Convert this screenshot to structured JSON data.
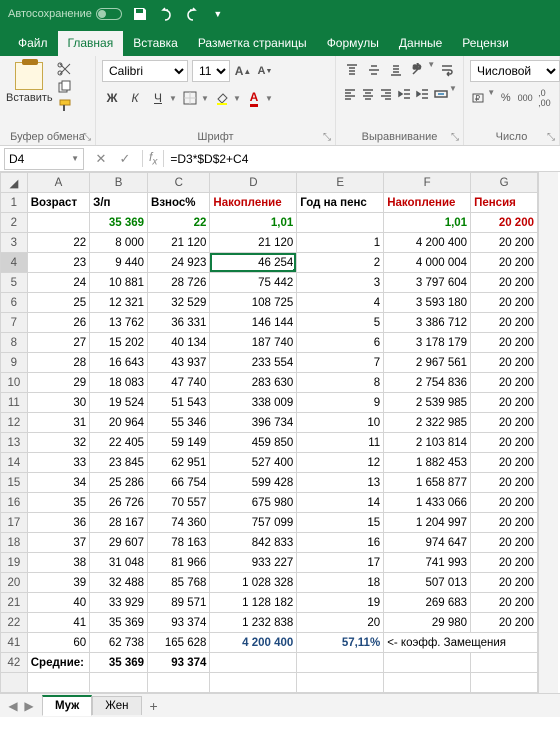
{
  "titlebar": {
    "autosave": "Автосохранение"
  },
  "tabs": {
    "file": "Файл",
    "home": "Главная",
    "insert": "Вставка",
    "layout": "Разметка страницы",
    "formulas": "Формулы",
    "data": "Данные",
    "review": "Рецензи"
  },
  "ribbon": {
    "clipboard": {
      "paste": "Вставить",
      "label": "Буфер обмена"
    },
    "font": {
      "name": "Calibri",
      "size": "11",
      "bold": "Ж",
      "italic": "К",
      "underline": "Ч",
      "label": "Шрифт"
    },
    "align": {
      "label": "Выравнивание"
    },
    "number": {
      "format": "Числовой",
      "label": "Число"
    }
  },
  "namebox": "D4",
  "formula": "=D3*$D$2+C4",
  "columns": [
    "A",
    "B",
    "C",
    "D",
    "E",
    "F",
    "G"
  ],
  "headers": {
    "a": "Возраст",
    "b": "З/п",
    "c": "Взнос%",
    "d": "Накопление",
    "e": "Год на пенс",
    "f": "Накопление",
    "g": "Пенсия"
  },
  "row2": {
    "b": "35 369",
    "c": "22",
    "d": "1,01",
    "f": "1,01",
    "g": "20 200"
  },
  "rows": [
    {
      "n": "3",
      "a": "22",
      "b": "8 000",
      "c": "21 120",
      "d": "21 120",
      "e": "1",
      "f": "4 200 400",
      "g": "20 200"
    },
    {
      "n": "4",
      "a": "23",
      "b": "9 440",
      "c": "24 923",
      "d": "46 254",
      "e": "2",
      "f": "4 000 004",
      "g": "20 200"
    },
    {
      "n": "5",
      "a": "24",
      "b": "10 881",
      "c": "28 726",
      "d": "75 442",
      "e": "3",
      "f": "3 797 604",
      "g": "20 200"
    },
    {
      "n": "6",
      "a": "25",
      "b": "12 321",
      "c": "32 529",
      "d": "108 725",
      "e": "4",
      "f": "3 593 180",
      "g": "20 200"
    },
    {
      "n": "7",
      "a": "26",
      "b": "13 762",
      "c": "36 331",
      "d": "146 144",
      "e": "5",
      "f": "3 386 712",
      "g": "20 200"
    },
    {
      "n": "8",
      "a": "27",
      "b": "15 202",
      "c": "40 134",
      "d": "187 740",
      "e": "6",
      "f": "3 178 179",
      "g": "20 200"
    },
    {
      "n": "9",
      "a": "28",
      "b": "16 643",
      "c": "43 937",
      "d": "233 554",
      "e": "7",
      "f": "2 967 561",
      "g": "20 200"
    },
    {
      "n": "10",
      "a": "29",
      "b": "18 083",
      "c": "47 740",
      "d": "283 630",
      "e": "8",
      "f": "2 754 836",
      "g": "20 200"
    },
    {
      "n": "11",
      "a": "30",
      "b": "19 524",
      "c": "51 543",
      "d": "338 009",
      "e": "9",
      "f": "2 539 985",
      "g": "20 200"
    },
    {
      "n": "12",
      "a": "31",
      "b": "20 964",
      "c": "55 346",
      "d": "396 734",
      "e": "10",
      "f": "2 322 985",
      "g": "20 200"
    },
    {
      "n": "13",
      "a": "32",
      "b": "22 405",
      "c": "59 149",
      "d": "459 850",
      "e": "11",
      "f": "2 103 814",
      "g": "20 200"
    },
    {
      "n": "14",
      "a": "33",
      "b": "23 845",
      "c": "62 951",
      "d": "527 400",
      "e": "12",
      "f": "1 882 453",
      "g": "20 200"
    },
    {
      "n": "15",
      "a": "34",
      "b": "25 286",
      "c": "66 754",
      "d": "599 428",
      "e": "13",
      "f": "1 658 877",
      "g": "20 200"
    },
    {
      "n": "16",
      "a": "35",
      "b": "26 726",
      "c": "70 557",
      "d": "675 980",
      "e": "14",
      "f": "1 433 066",
      "g": "20 200"
    },
    {
      "n": "17",
      "a": "36",
      "b": "28 167",
      "c": "74 360",
      "d": "757 099",
      "e": "15",
      "f": "1 204 997",
      "g": "20 200"
    },
    {
      "n": "18",
      "a": "37",
      "b": "29 607",
      "c": "78 163",
      "d": "842 833",
      "e": "16",
      "f": "974 647",
      "g": "20 200"
    },
    {
      "n": "19",
      "a": "38",
      "b": "31 048",
      "c": "81 966",
      "d": "933 227",
      "e": "17",
      "f": "741 993",
      "g": "20 200"
    },
    {
      "n": "20",
      "a": "39",
      "b": "32 488",
      "c": "85 768",
      "d": "1 028 328",
      "e": "18",
      "f": "507 013",
      "g": "20 200"
    },
    {
      "n": "21",
      "a": "40",
      "b": "33 929",
      "c": "89 571",
      "d": "1 128 182",
      "e": "19",
      "f": "269 683",
      "g": "20 200"
    },
    {
      "n": "22",
      "a": "41",
      "b": "35 369",
      "c": "93 374",
      "d": "1 232 838",
      "e": "20",
      "f": "29 980",
      "g": "20 200"
    }
  ],
  "row41": {
    "n": "41",
    "a": "60",
    "b": "62 738",
    "c": "165 628",
    "d": "4 200 400",
    "e": "57,11%",
    "f": "<- коэфф. Замещения"
  },
  "row42": {
    "n": "42",
    "a": "Средние:",
    "b": "35 369",
    "c": "93 374"
  },
  "sheets": {
    "s1": "Муж",
    "s2": "Жен",
    "add": "+"
  }
}
